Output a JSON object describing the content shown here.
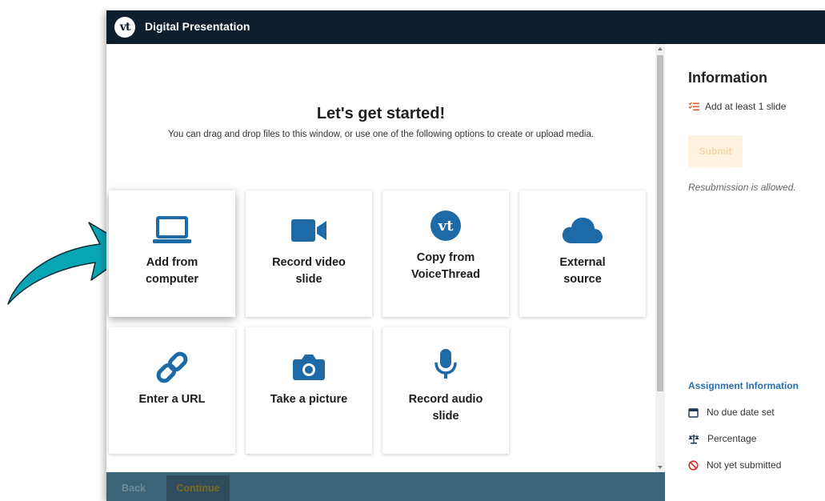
{
  "app": {
    "title": "Digital Presentation",
    "logo_text": "vt"
  },
  "main": {
    "heading": "Let's get started!",
    "subtext": "You can drag and drop files to this window, or use one of the following options to create or upload media.",
    "options": [
      {
        "label_line1": "Add from",
        "label_line2": "computer",
        "icon": "laptop-icon"
      },
      {
        "label_line1": "Record video",
        "label_line2": "slide",
        "icon": "video-camera-icon"
      },
      {
        "label_line1": "Copy from",
        "label_line2": "VoiceThread",
        "icon": "voicethread-logo-icon"
      },
      {
        "label_line1": "External",
        "label_line2": "source",
        "icon": "cloud-icon"
      },
      {
        "label_line1": "Enter a URL",
        "label_line2": "",
        "icon": "link-icon"
      },
      {
        "label_line1": "Take a picture",
        "label_line2": "",
        "icon": "camera-icon"
      },
      {
        "label_line1": "Record audio",
        "label_line2": "slide",
        "icon": "microphone-icon"
      }
    ]
  },
  "footer": {
    "back_label": "Back",
    "continue_label": "Continue"
  },
  "sidebar": {
    "title": "Information",
    "requirement": "Add at least 1 slide",
    "submit_label": "Submit",
    "resubmission": "Resubmission is allowed.",
    "assignment_title": "Assignment Information",
    "due": "No due date set",
    "grading": "Percentage",
    "status": "Not yet submitted"
  },
  "colors": {
    "titlebar": "#0d1e2e",
    "icon_blue": "#1e6aa6",
    "footer": "#3c6478",
    "arrow": "#0aa5b5",
    "requirement_icon": "#e25b2a",
    "status_icon": "#d93025",
    "assignment_title": "#2b6fad"
  }
}
